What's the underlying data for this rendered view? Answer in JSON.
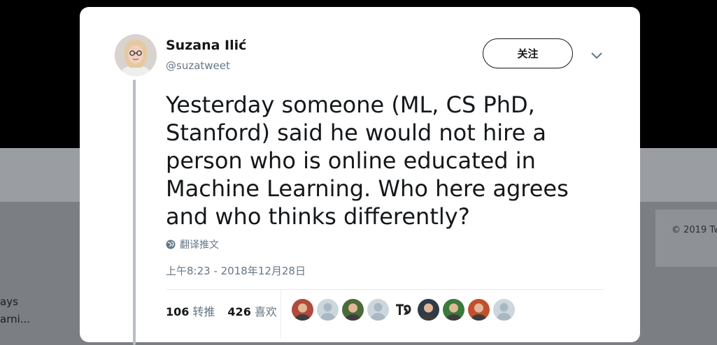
{
  "tweet": {
    "author_name": "Suzana Ilić",
    "handle": "@suzatweet",
    "follow_label": "关注",
    "text": "Yesterday someone (ML, CS PhD, Stanford) said he would not hire a person who is online educated in Machine Learning. Who here agrees and who thinks differently?",
    "translate_label": "翻译推文",
    "timestamp": "上午8:23 - 2018年12月28日",
    "retweets_count": "106",
    "retweets_label": "转推",
    "likes_count": "426",
    "likes_label": "喜欢"
  },
  "background": {
    "copyright": "© 2019 Tw",
    "left_snippet_1": "ays",
    "left_snippet_2": "arni..."
  },
  "likers": [
    {
      "icon": "user-avatar-icon",
      "color": "#b04a3c"
    },
    {
      "icon": "default-avatar-icon",
      "color": "#aab8c2"
    },
    {
      "icon": "user-avatar-icon",
      "color": "#4c6b3a"
    },
    {
      "icon": "default-avatar-icon",
      "color": "#aab8c2"
    },
    {
      "icon": "logo-avatar-icon",
      "color": "#222222"
    },
    {
      "icon": "user-avatar-icon",
      "color": "#2f3b49"
    },
    {
      "icon": "user-avatar-icon",
      "color": "#3a7a3a"
    },
    {
      "icon": "user-avatar-icon",
      "color": "#c2502e"
    },
    {
      "icon": "default-avatar-icon",
      "color": "#aab8c2"
    }
  ],
  "colors": {
    "text_primary": "#14171a",
    "text_secondary": "#657786",
    "divider": "#e6ecf0",
    "overlay_bg": "#7b7f84"
  }
}
